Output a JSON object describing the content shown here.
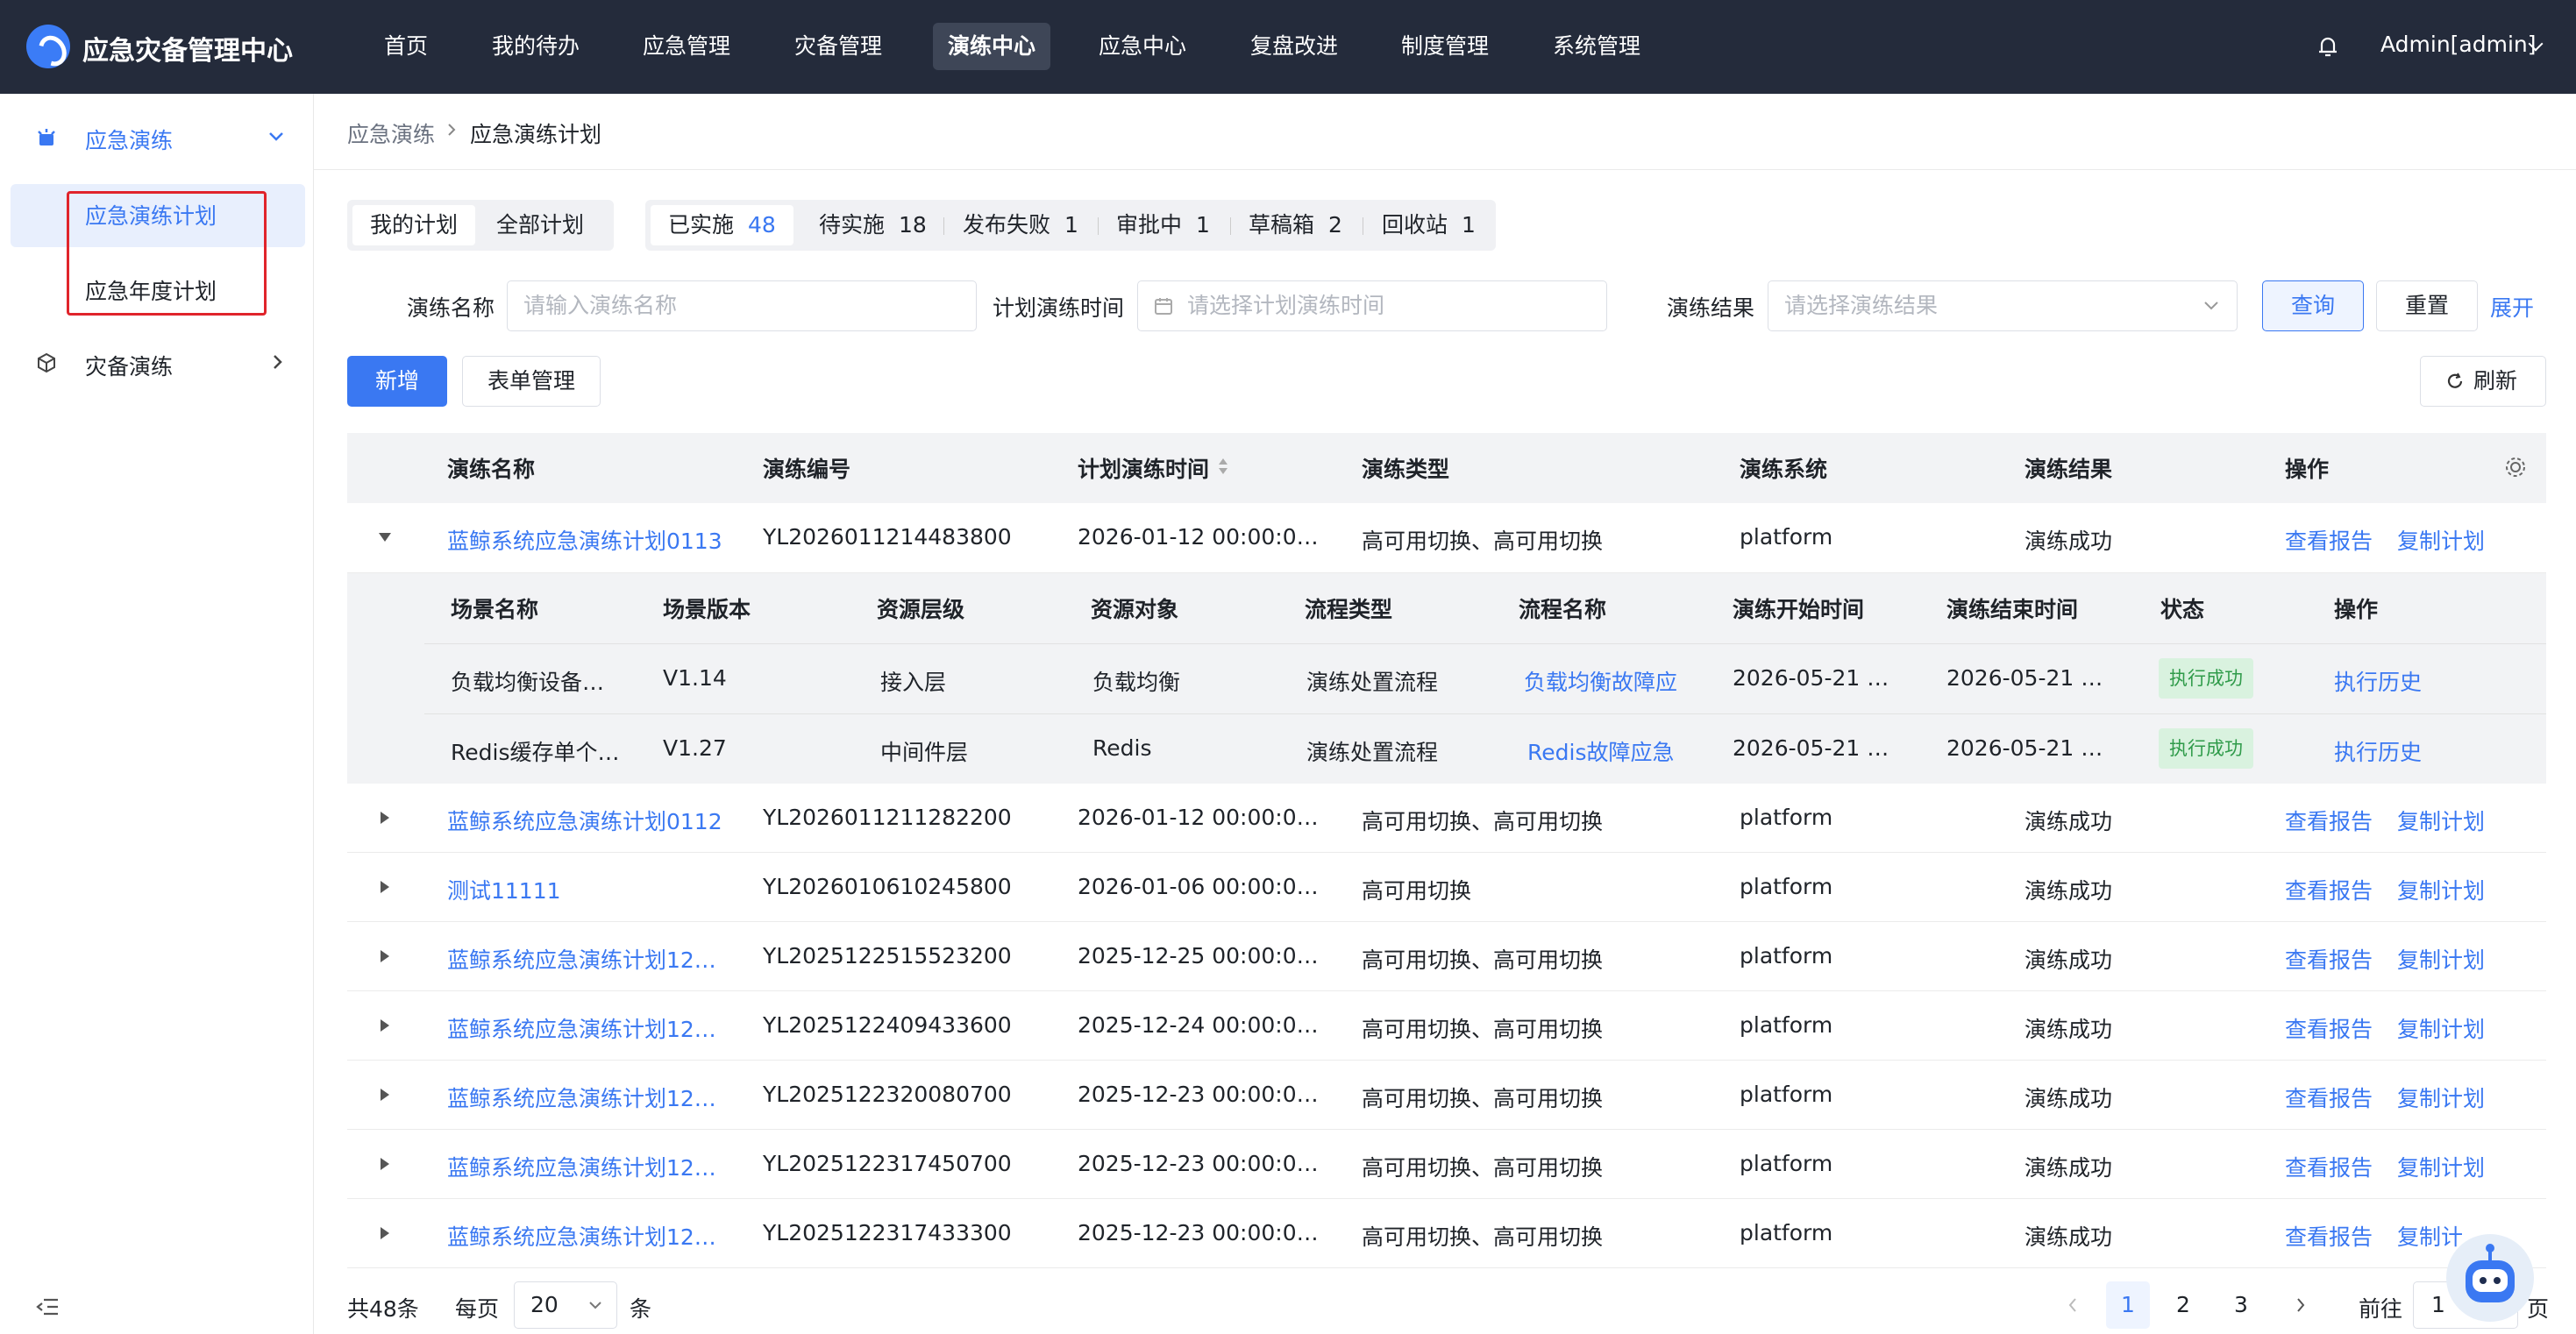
{
  "header": {
    "app_name": "应急灾备管理中心",
    "nav": [
      "首页",
      "我的待办",
      "应急管理",
      "灾备管理",
      "演练中心",
      "应急中心",
      "复盘改进",
      "制度管理",
      "系统管理"
    ],
    "active_nav": "演练中心",
    "user": "Admin[admin]"
  },
  "sidebar": {
    "group1": "应急演练",
    "items": [
      "应急演练计划",
      "应急年度计划"
    ],
    "group2": "灾备演练"
  },
  "breadcrumb": {
    "parent": "应急演练",
    "current": "应急演练计划"
  },
  "tabs": {
    "scope": [
      "我的计划",
      "全部计划"
    ],
    "status": [
      {
        "label": "已实施",
        "count": "48"
      },
      {
        "label": "待实施",
        "count": "18"
      },
      {
        "label": "发布失败",
        "count": "1"
      },
      {
        "label": "审批中",
        "count": "1"
      },
      {
        "label": "草稿箱",
        "count": "2"
      },
      {
        "label": "回收站",
        "count": "1"
      }
    ]
  },
  "filters": {
    "name_label": "演练名称",
    "name_placeholder": "请输入演练名称",
    "time_label": "计划演练时间",
    "time_placeholder": "请选择计划演练时间",
    "result_label": "演练结果",
    "result_placeholder": "请选择演练结果",
    "query": "查询",
    "reset": "重置",
    "expand": "展开"
  },
  "toolbar": {
    "add": "新增",
    "form_manage": "表单管理",
    "refresh": "刷新"
  },
  "table": {
    "headers": [
      "演练名称",
      "演练编号",
      "计划演练时间",
      "演练类型",
      "演练系统",
      "演练结果",
      "操作"
    ],
    "actions": [
      "查看报告",
      "复制计划"
    ],
    "rows": [
      {
        "name": "蓝鲸系统应急演练计划0113",
        "code": "YL2026011214483800",
        "time": "2026-01-12 00:00:0…",
        "type": "高可用切换、高可用切换",
        "system": "platform",
        "result": "演练成功"
      },
      {
        "name": "蓝鲸系统应急演练计划0112",
        "code": "YL2026011211282200",
        "time": "2026-01-12 00:00:0…",
        "type": "高可用切换、高可用切换",
        "system": "platform",
        "result": "演练成功"
      },
      {
        "name": "测试11111",
        "code": "YL2026010610245800",
        "time": "2026-01-06 00:00:0…",
        "type": "高可用切换",
        "system": "platform",
        "result": "演练成功"
      },
      {
        "name": "蓝鲸系统应急演练计划12…",
        "code": "YL2025122515523200",
        "time": "2025-12-25 00:00:0…",
        "type": "高可用切换、高可用切换",
        "system": "platform",
        "result": "演练成功"
      },
      {
        "name": "蓝鲸系统应急演练计划12…",
        "code": "YL2025122409433600",
        "time": "2025-12-24 00:00:0…",
        "type": "高可用切换、高可用切换",
        "system": "platform",
        "result": "演练成功"
      },
      {
        "name": "蓝鲸系统应急演练计划12…",
        "code": "YL2025122320080700",
        "time": "2025-12-23 00:00:0…",
        "type": "高可用切换、高可用切换",
        "system": "platform",
        "result": "演练成功"
      },
      {
        "name": "蓝鲸系统应急演练计划12…",
        "code": "YL2025122317450700",
        "time": "2025-12-23 00:00:0…",
        "type": "高可用切换、高可用切换",
        "system": "platform",
        "result": "演练成功"
      },
      {
        "name": "蓝鲸系统应急演练计划12…",
        "code": "YL2025122317433300",
        "time": "2025-12-23 00:00:0…",
        "type": "高可用切换、高可用切换",
        "system": "platform",
        "result": "演练成功"
      }
    ],
    "last_row_actions": [
      "查看报告",
      "复制计…"
    ]
  },
  "subtable": {
    "headers": [
      "场景名称",
      "场景版本",
      "资源层级",
      "资源对象",
      "流程类型",
      "流程名称",
      "演练开始时间",
      "演练结束时间",
      "状态",
      "操作"
    ],
    "rows": [
      {
        "scene": "负载均衡设备…",
        "version": "V1.14",
        "layer": "接入层",
        "object": "负载均衡",
        "flow_type": "演练处置流程",
        "flow_name": "负载均衡故障应",
        "start": "2026-05-21 …",
        "end": "2026-05-21 …",
        "status": "执行成功",
        "action": "执行历史"
      },
      {
        "scene": "Redis缓存单个…",
        "version": "V1.27",
        "layer": "中间件层",
        "object": "Redis",
        "flow_type": "演练处置流程",
        "flow_name": "Redis故障应急",
        "start": "2026-05-21 …",
        "end": "2026-05-21 …",
        "status": "执行成功",
        "action": "执行历史"
      }
    ]
  },
  "pagination": {
    "total": "共48条",
    "per_page_label": "每页",
    "per_page": "20",
    "unit": "条",
    "pages": [
      "1",
      "2",
      "3"
    ],
    "goto_label": "前往",
    "goto_value": "1",
    "goto_suffix": "页"
  }
}
